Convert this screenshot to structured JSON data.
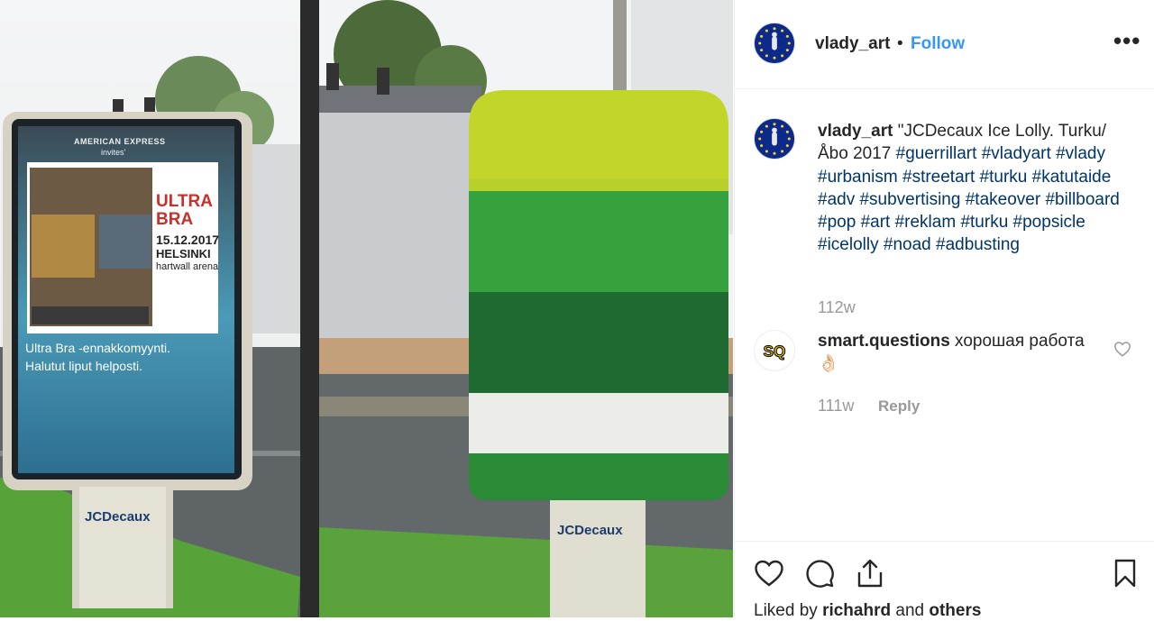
{
  "photo": {
    "left_poster": {
      "sponsor": "AMERICAN EXPRESS",
      "sponsor_sub": "invites'",
      "band": "ULTRA BRA",
      "date": "15.12.2017",
      "city": "HELSINKI",
      "venue": "hartwall arena",
      "headline1": "Ultra Bra -ennakkomyynti.",
      "headline2": "Halutut liput helposti.",
      "brand": "JCDecaux"
    },
    "right_sign": {
      "brand": "JCDecaux"
    },
    "colors": {
      "lime": "#c2d62a",
      "green": "#36a23e",
      "dark_green": "#1f6a31",
      "white_band": "#ecece8",
      "green_bottom": "#2a8a36"
    }
  },
  "header": {
    "username": "vlady_art",
    "separator": "•",
    "follow_label": "Follow",
    "more_label": "•••",
    "accent_color": "#3897f0"
  },
  "caption": {
    "username": "vlady_art",
    "text": "\"JCDecaux Ice Lolly. Turku/Åbo 2017",
    "hashtags": [
      "#guerrillart",
      "#vladyart",
      "#vlady",
      "#urbanism",
      "#streetart",
      "#turku",
      "#katutaide",
      "#adv",
      "#subvertising",
      "#takeover",
      "#billboard",
      "#pop",
      "#art",
      "#reklam",
      "#turku",
      "#popsicle",
      "#icelolly",
      "#noad",
      "#adbusting"
    ],
    "time": "112w"
  },
  "comment": {
    "username": "smart.questions",
    "avatar_text": "SQ",
    "text": "хорошая работа",
    "emoji": "👌🏻",
    "time": "111w",
    "reply_label": "Reply"
  },
  "actions": {
    "icons": [
      "heart-icon",
      "comment-icon",
      "share-icon",
      "bookmark-icon"
    ],
    "liked_prefix": "Liked by",
    "liked_user": "richahrd",
    "liked_and": "and",
    "liked_others": "others"
  }
}
